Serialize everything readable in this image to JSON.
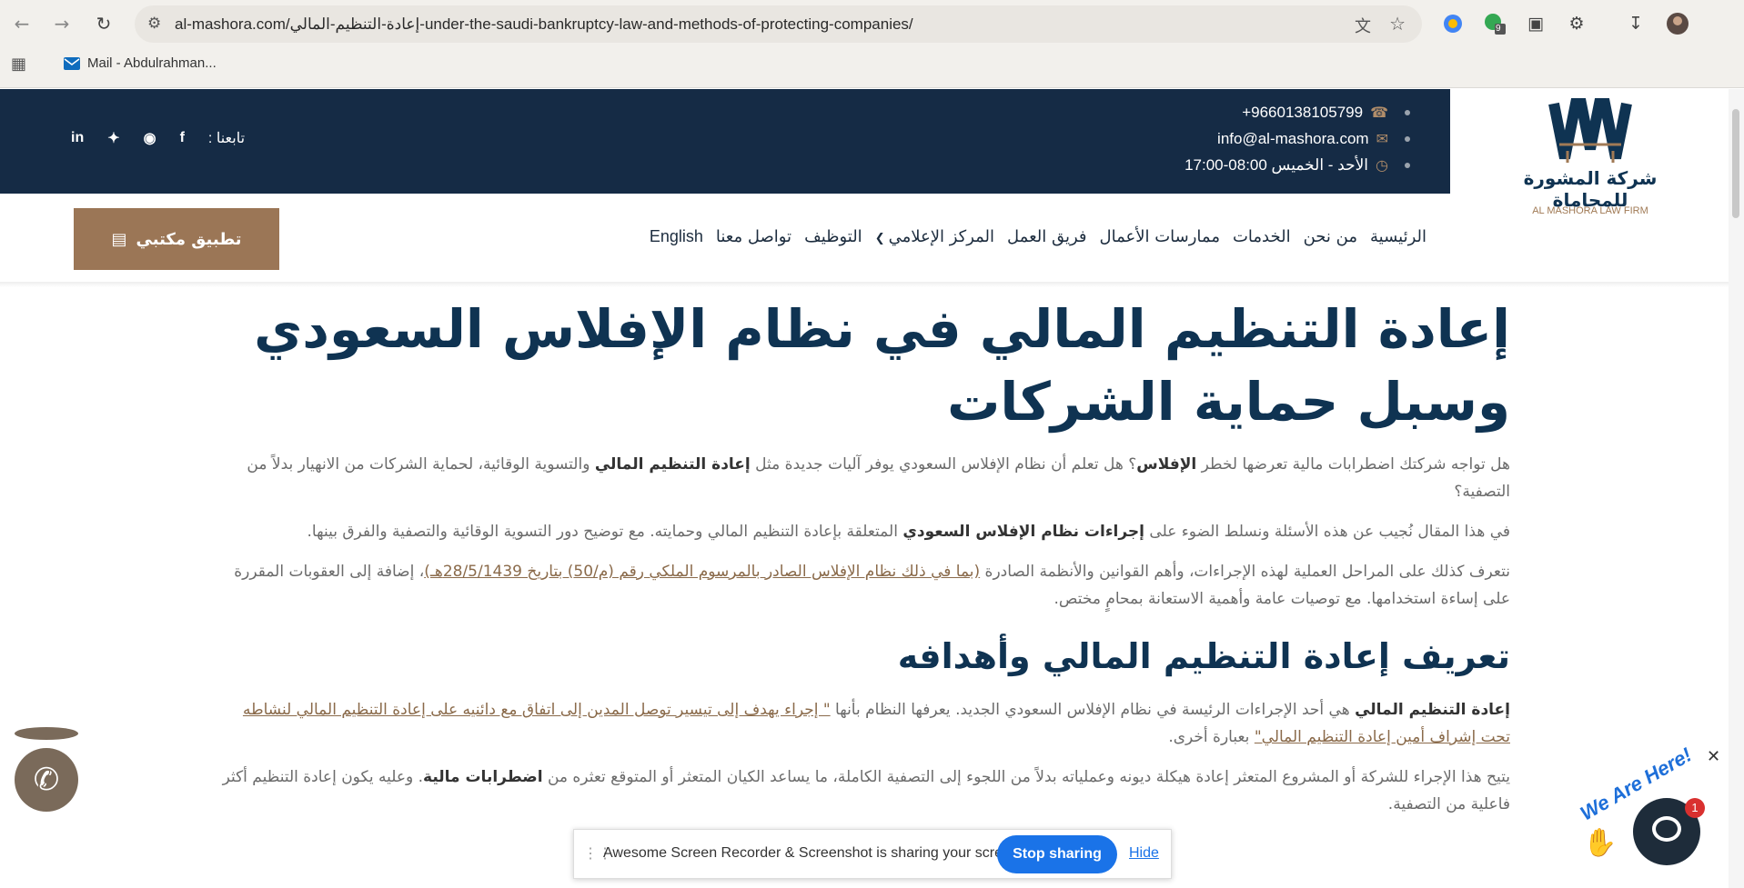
{
  "browser": {
    "url": "al-mashora.com/إعادة-التنظيم-المالي-under-the-saudi-bankruptcy-law-and-methods-of-protecting-companies/",
    "bookmark": "Mail - Abdulrahman...",
    "extension_badge": "9"
  },
  "topbar": {
    "phone": "+9660138105799",
    "email": "info@al-mashora.com",
    "hours": "الأحد - الخميس 08:00-17:00",
    "follow_label": "تابعنا :"
  },
  "logo": {
    "name_ar": "شركة المشورة للمحاماة",
    "name_en": "AL MASHORA LAW FIRM"
  },
  "nav": {
    "items": [
      "الرئيسية",
      "من نحن",
      "الخدمات",
      "ممارسات الأعمال",
      "فريق العمل",
      "المركز الإعلامي",
      "التوظيف",
      "تواصل معنا",
      "English"
    ],
    "app_button": "تطبيق مكتبي"
  },
  "article": {
    "title": "إعادة التنظيم المالي في نظام الإفلاس السعودي وسبل حماية الشركات",
    "p1": {
      "t1": "هل تواجه شركتك اضطرابات مالية تعرضها لخطر ",
      "b1": "الإفلاس",
      "t2": "؟ هل تعلم أن نظام الإفلاس السعودي يوفر آليات جديدة مثل ",
      "b2": "إعادة التنظيم المالي",
      "t3": " والتسوية الوقائية، لحماية الشركات من الانهيار بدلاً من التصفية؟"
    },
    "p2": {
      "t1": "في هذا المقال نُجيب عن هذه الأسئلة ونسلط الضوء على ",
      "b1": "إجراءات نظام الإفلاس السعودي",
      "t2": " المتعلقة بإعادة التنظيم المالي وحمايته. مع توضيح دور التسوية الوقائية والتصفية والفرق بينها."
    },
    "p3": {
      "t1": "نتعرف كذلك على المراحل العملية لهذه الإجراءات، وأهم القوانين والأنظمة الصادرة ",
      "a1": "(بما في ذلك نظام الإفلاس الصادر بالمرسوم الملكي رقم (م/50) بتاريخ 28/5/1439هـ)",
      "t2": "، إضافة إلى العقوبات المقررة على إساءة استخدامها. مع توصيات عامة وأهمية الاستعانة بمحامٍ مختص."
    },
    "h2": "تعريف إعادة التنظيم المالي وأهدافه",
    "p4": {
      "b1": "إعادة التنظيم المالي",
      "t1": " هي أحد الإجراءات الرئيسة في نظام الإفلاس السعودي الجديد. يعرفها النظام بأنها ",
      "a1": "\" إجراء يهدف إلى تيسير توصل المدين إلى اتفاق مع دائنيه على إعادة التنظيم المالي لنشاطه تحت إشراف أمين إعادة التنظيم المالي\"",
      "t2": " بعبارة أخرى."
    },
    "p5": {
      "t1": "يتيح هذا الإجراء للشركة أو المشروع المتعثر إعادة هيكلة ديونه وعملياته بدلاً من اللجوء إلى التصفية الكاملة، ما يساعد الكيان المتعثر أو المتوقع تعثره من ",
      "b1": "اضطرابات مالية",
      "t2": ". وعليه يكون إعادة التنظيم أكثر فاعلية من التصفية."
    }
  },
  "sharebar": {
    "text": "Awesome Screen Recorder & Screenshot is sharing your screen.",
    "stop": "Stop sharing",
    "hide": "Hide"
  },
  "chat": {
    "label": "We Are Here!",
    "badge": "1"
  }
}
